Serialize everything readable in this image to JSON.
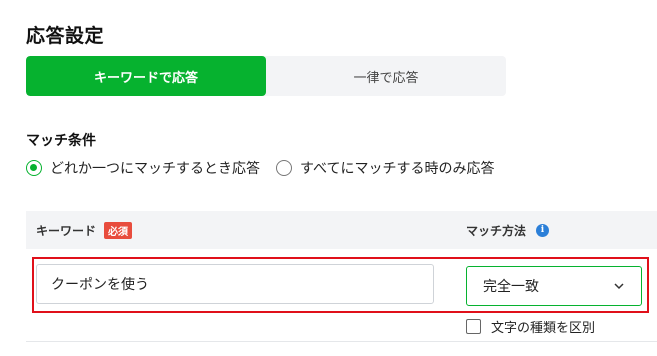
{
  "page": {
    "title": "応答設定"
  },
  "tabs": [
    {
      "label": "キーワードで応答",
      "active": true
    },
    {
      "label": "一律で応答",
      "active": false
    }
  ],
  "match_condition": {
    "label": "マッチ条件",
    "options": [
      {
        "label": "どれか一つにマッチするとき応答",
        "checked": true
      },
      {
        "label": "すべてにマッチする時のみ応答",
        "checked": false
      }
    ]
  },
  "table": {
    "keyword_header": "キーワード",
    "required_badge": "必須",
    "match_header": "マッチ方法",
    "info_icon": "info-icon"
  },
  "row": {
    "keyword_value": "クーポンを使う",
    "match_method": "完全一致",
    "case_sensitive_label": "文字の種類を区別",
    "case_sensitive_checked": false
  },
  "colors": {
    "accent": "#06b22f",
    "badge": "#e84c3d",
    "highlight": "#e0101a",
    "info": "#2b7fd8"
  }
}
